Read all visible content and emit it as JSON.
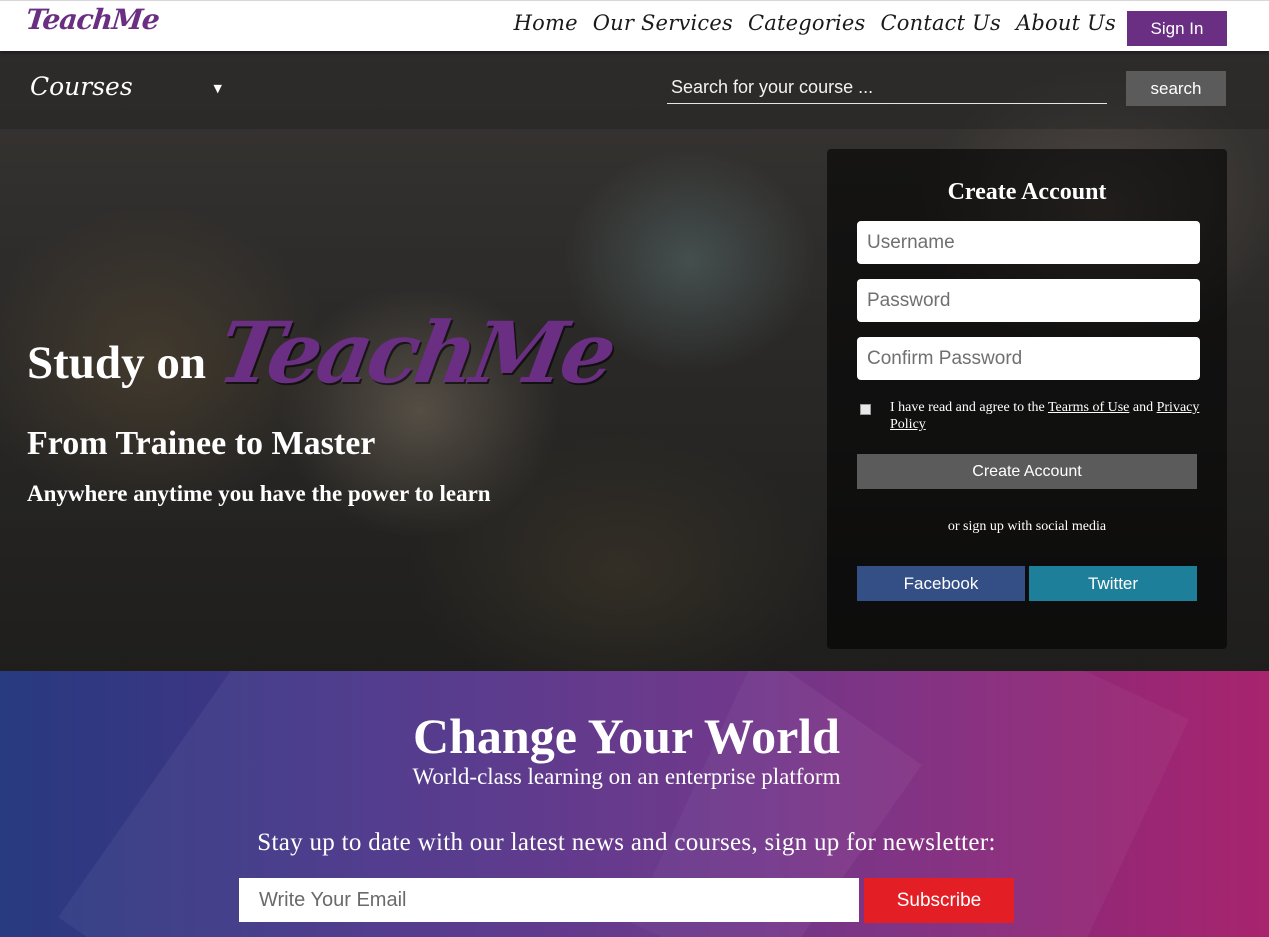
{
  "brand": {
    "name": "TeachMe",
    "color": "#6a2e82"
  },
  "nav": {
    "links": [
      "Home",
      "Our Services",
      "Categories",
      "Contact Us",
      "About Us"
    ],
    "signin_label": "Sign In"
  },
  "search_bar": {
    "category_selected": "Courses",
    "placeholder": "Search for your course ...",
    "button_label": "search"
  },
  "hero": {
    "study_prefix": "Study on",
    "brand_word": "TeachMe",
    "heading": "From Trainee to Master",
    "subheading": "Anywhere anytime you have the power to learn"
  },
  "account_form": {
    "title": "Create Account",
    "username_placeholder": "Username",
    "password_placeholder": "Password",
    "confirm_placeholder": "Confirm Password",
    "agree_prefix": "I have read and agree to the",
    "terms_label": "Tearms of Use",
    "agree_and": "and",
    "privacy_label": "Privacy Policy",
    "submit_label": "Create Account",
    "social_text": "or sign up with social media",
    "facebook_label": "Facebook",
    "twitter_label": "Twitter",
    "facebook_color": "#334f86",
    "twitter_color": "#1e7f9a"
  },
  "newsletter": {
    "title": "Change Your World",
    "subtitle": "World-class learning on an enterprise platform",
    "prompt": "Stay up to date with our latest news and courses, sign up for newsletter:",
    "email_placeholder": "Write Your Email",
    "subscribe_label": "Subscribe",
    "subscribe_color": "#e31e24"
  }
}
